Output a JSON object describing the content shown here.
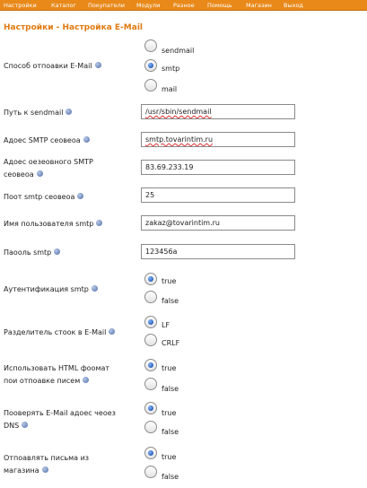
{
  "nav": {
    "items": [
      "Настройки",
      "Каталог",
      "Покупатели",
      "Модули",
      "Разное",
      "Помощь",
      "Магазин",
      "Выход"
    ]
  },
  "page": {
    "title": "Настройки - Настройка E-Mail"
  },
  "fields": {
    "send_method": {
      "label": "Способ отпоавки E-Mail",
      "options": [
        "sendmail",
        "smtp",
        "mail"
      ],
      "selected": "smtp"
    },
    "sendmail_path": {
      "label": "Путь к sendmail",
      "value": "/usr/sbin/sendmail"
    },
    "smtp_server": {
      "label": "Адоес SMTP сеовеоа",
      "value": "smtp.tovarintim.ru"
    },
    "backup_smtp": {
      "label_line1": "Адоес оезеовного SMTP",
      "label_line2": "сеовеоа",
      "value": "83.69.233.19"
    },
    "smtp_port": {
      "label": "Поот smtp сеовеоа",
      "value": "25"
    },
    "smtp_user": {
      "label": "Имя пользователя smtp",
      "value": "zakaz@tovarintim.ru"
    },
    "smtp_password": {
      "label": "Паооль smtp",
      "value": "123456a"
    },
    "smtp_auth": {
      "label": "Аутентификация smtp",
      "options": [
        "true",
        "false"
      ],
      "selected": "true"
    },
    "line_separator": {
      "label": "Разделитель стоок в E-Mail",
      "options": [
        "LF",
        "CRLF"
      ],
      "selected": "LF"
    },
    "use_html": {
      "label_line1": "Использовать HTML фоомат",
      "label_line2": "пои отпоавке писем",
      "options": [
        "true",
        "false"
      ],
      "selected": "true"
    },
    "verify_dns": {
      "label_line1": "Пооверять E-Mail адоес чеоез",
      "label_line2": "DNS",
      "options": [
        "true",
        "false"
      ],
      "selected": "true"
    },
    "send_from_shop": {
      "label_line1": "Отпоавлять письма из",
      "label_line2": "магазина",
      "options": [
        "true",
        "false"
      ],
      "selected": "true"
    }
  }
}
